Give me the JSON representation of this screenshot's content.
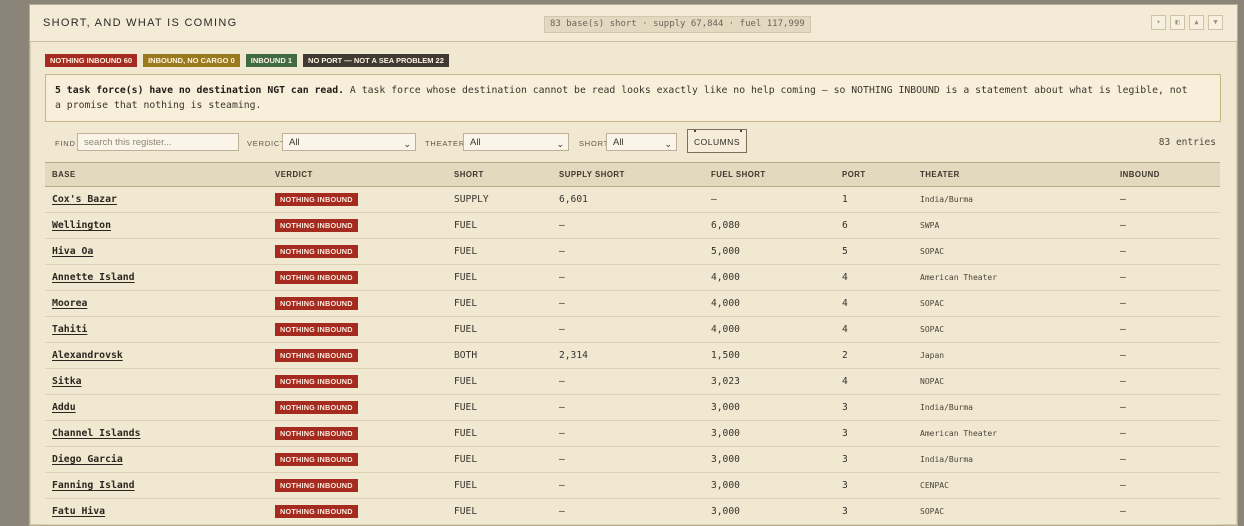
{
  "header": {
    "title": "SHORT, AND WHAT IS COMING",
    "summary": "83 base(s) short · supply 67,844 · fuel 117,999",
    "window_buttons": [
      "filter-icon",
      "panel-icon",
      "up-icon",
      "down-icon"
    ]
  },
  "chips": [
    {
      "label": "NOTHING INBOUND 60",
      "color": "#a52a1f"
    },
    {
      "label": "INBOUND, NO CARGO 0",
      "color": "#9a7a1e"
    },
    {
      "label": "INBOUND 1",
      "color": "#3f6a44"
    },
    {
      "label": "NO PORT — NOT A SEA PROBLEM 22",
      "color": "#3f3b33"
    }
  ],
  "notice": {
    "bold": "5 task force(s) have no destination NGT can read.",
    "text": " A task force whose destination cannot be read looks exactly like no help coming — so NOTHING INBOUND is a statement about what is legible, not a promise that nothing is steaming."
  },
  "filters": {
    "find_label": "FIND",
    "search_placeholder": "search this register...",
    "verdict_label": "VERDICT",
    "verdict_value": "All",
    "theater_label": "THEATER",
    "theater_value": "All",
    "short_label": "SHORT",
    "short_value": "All",
    "columns_button": "COLUMNS",
    "entries": "83 entries"
  },
  "table": {
    "columns": [
      "BASE",
      "VERDICT",
      "SHORT",
      "SUPPLY SHORT",
      "FUEL SHORT",
      "PORT",
      "THEATER",
      "INBOUND"
    ],
    "rows": [
      {
        "base": "Cox's Bazar",
        "verdict": "NOTHING INBOUND",
        "short": "SUPPLY",
        "supply": "6,601",
        "fuel": "—",
        "port": "1",
        "theater": "India/Burma",
        "inbound": "—"
      },
      {
        "base": "Wellington",
        "verdict": "NOTHING INBOUND",
        "short": "FUEL",
        "supply": "—",
        "fuel": "6,080",
        "port": "6",
        "theater": "SWPA",
        "inbound": "—"
      },
      {
        "base": "Hiva Oa",
        "verdict": "NOTHING INBOUND",
        "short": "FUEL",
        "supply": "—",
        "fuel": "5,000",
        "port": "5",
        "theater": "SOPAC",
        "inbound": "—"
      },
      {
        "base": "Annette Island",
        "verdict": "NOTHING INBOUND",
        "short": "FUEL",
        "supply": "—",
        "fuel": "4,000",
        "port": "4",
        "theater": "American Theater",
        "inbound": "—"
      },
      {
        "base": "Moorea",
        "verdict": "NOTHING INBOUND",
        "short": "FUEL",
        "supply": "—",
        "fuel": "4,000",
        "port": "4",
        "theater": "SOPAC",
        "inbound": "—"
      },
      {
        "base": "Tahiti",
        "verdict": "NOTHING INBOUND",
        "short": "FUEL",
        "supply": "—",
        "fuel": "4,000",
        "port": "4",
        "theater": "SOPAC",
        "inbound": "—"
      },
      {
        "base": "Alexandrovsk",
        "verdict": "NOTHING INBOUND",
        "short": "BOTH",
        "supply": "2,314",
        "fuel": "1,500",
        "port": "2",
        "theater": "Japan",
        "inbound": "—"
      },
      {
        "base": "Sitka",
        "verdict": "NOTHING INBOUND",
        "short": "FUEL",
        "supply": "—",
        "fuel": "3,023",
        "port": "4",
        "theater": "NOPAC",
        "inbound": "—"
      },
      {
        "base": "Addu",
        "verdict": "NOTHING INBOUND",
        "short": "FUEL",
        "supply": "—",
        "fuel": "3,000",
        "port": "3",
        "theater": "India/Burma",
        "inbound": "—"
      },
      {
        "base": "Channel Islands",
        "verdict": "NOTHING INBOUND",
        "short": "FUEL",
        "supply": "—",
        "fuel": "3,000",
        "port": "3",
        "theater": "American Theater",
        "inbound": "—"
      },
      {
        "base": "Diego Garcia",
        "verdict": "NOTHING INBOUND",
        "short": "FUEL",
        "supply": "—",
        "fuel": "3,000",
        "port": "3",
        "theater": "India/Burma",
        "inbound": "—"
      },
      {
        "base": "Fanning Island",
        "verdict": "NOTHING INBOUND",
        "short": "FUEL",
        "supply": "—",
        "fuel": "3,000",
        "port": "3",
        "theater": "CENPAC",
        "inbound": "—"
      },
      {
        "base": "Fatu Hiva",
        "verdict": "NOTHING INBOUND",
        "short": "FUEL",
        "supply": "—",
        "fuel": "3,000",
        "port": "3",
        "theater": "SOPAC",
        "inbound": "—"
      }
    ]
  }
}
